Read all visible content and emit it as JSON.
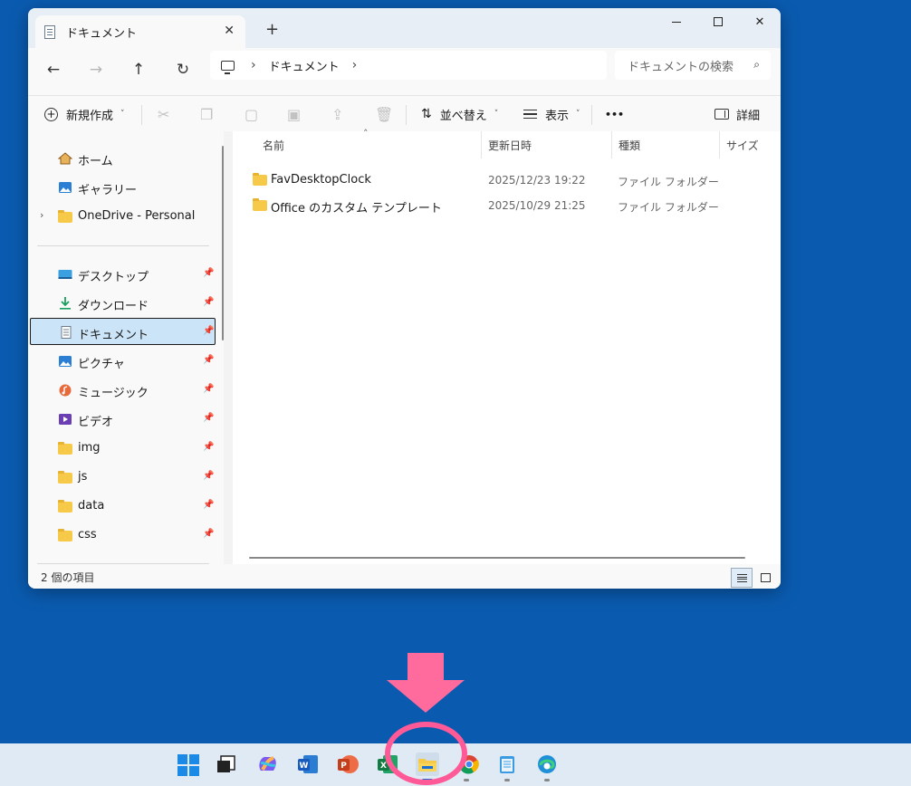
{
  "window": {
    "tab_title": "ドキュメント",
    "tab_close": "✕",
    "new_tab": "+",
    "minimize": "",
    "maximize": "",
    "close": "✕"
  },
  "nav": {
    "back": "←",
    "forward": "→",
    "up": "↑",
    "refresh": "↻",
    "address_chevron": "›",
    "address_segments": [
      "ドキュメント"
    ],
    "search_placeholder": "ドキュメントの検索",
    "search_icon": "🔍"
  },
  "toolbar": {
    "new_label": "新規作成",
    "sort_label": "並べ替え",
    "view_label": "表示",
    "more_label": "•••",
    "details_label": "詳細",
    "caret": "˅"
  },
  "sidebar": {
    "groups": [
      {
        "label": "ホーム",
        "icon": "home-icon"
      },
      {
        "label": "ギャラリー",
        "icon": "gallery-icon"
      },
      {
        "label": "OneDrive - Personal",
        "icon": "folder-icon",
        "expand": "›"
      }
    ],
    "quick_access": [
      {
        "label": "デスクトップ",
        "icon": "desktop-icon",
        "pinned": true
      },
      {
        "label": "ダウンロード",
        "icon": "download-icon",
        "pinned": true
      },
      {
        "label": "ドキュメント",
        "icon": "document-icon",
        "pinned": true,
        "selected": true
      },
      {
        "label": "ピクチャ",
        "icon": "pictures-icon",
        "pinned": true
      },
      {
        "label": "ミュージック",
        "icon": "music-icon",
        "pinned": true
      },
      {
        "label": "ビデオ",
        "icon": "video-icon",
        "pinned": true
      },
      {
        "label": "img",
        "icon": "folder-icon",
        "pinned": true
      },
      {
        "label": "js",
        "icon": "folder-icon",
        "pinned": true
      },
      {
        "label": "data",
        "icon": "folder-icon",
        "pinned": true
      },
      {
        "label": "css",
        "icon": "folder-icon",
        "pinned": true
      }
    ],
    "pin_glyph": "📌"
  },
  "content": {
    "columns": [
      "名前",
      "更新日時",
      "種類",
      "サイズ"
    ],
    "sort_caret": "˄",
    "rows": [
      {
        "name": "FavDesktopClock",
        "date": "2025/12/23 19:22",
        "type": "ファイル フォルダー"
      },
      {
        "name": "Office のカスタム テンプレート",
        "date": "2025/10/29 21:25",
        "type": "ファイル フォルダー"
      }
    ]
  },
  "status": {
    "item_count": "2 個の項目"
  },
  "taskbar": {
    "apps": [
      "start-icon",
      "task-view-icon",
      "copilot-icon",
      "word-icon",
      "powerpoint-icon",
      "excel-icon",
      "file-explorer-icon",
      "chrome-icon",
      "notepad-icon",
      "edge-icon"
    ],
    "colors": {
      "accent": "#1a8ae6",
      "highlight": "#ff5a97"
    }
  }
}
